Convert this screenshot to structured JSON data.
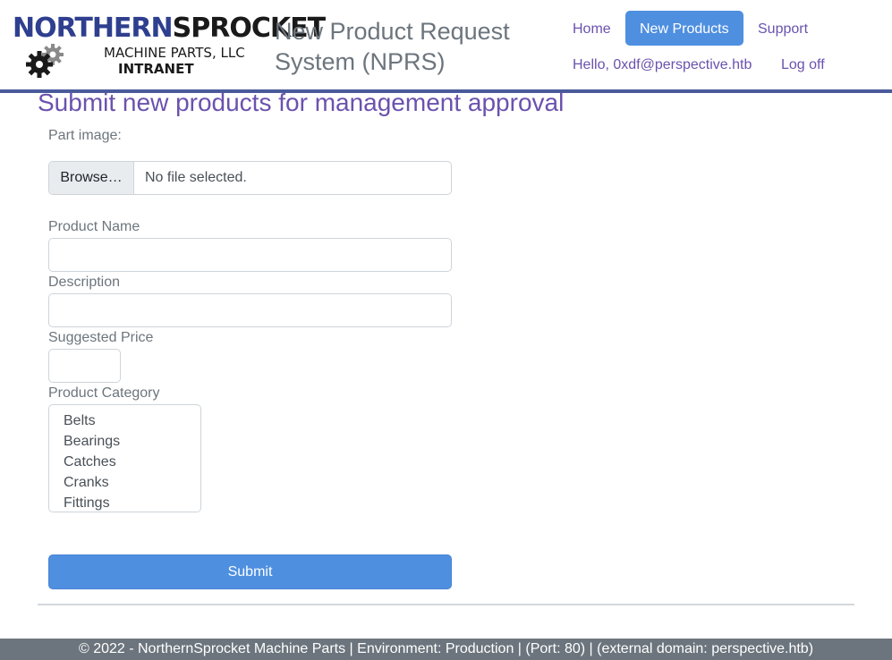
{
  "logo": {
    "top_left": "NORTHERN",
    "top_right": "SPROCKET",
    "middle": "MACHINE PARTS, LLC",
    "bottom": "INTRANET"
  },
  "header": {
    "app_title": "New Product Request System (NPRS)"
  },
  "nav": {
    "home": "Home",
    "new_products": "New Products",
    "support": "Support",
    "greeting": "Hello, 0xdf@perspective.htb",
    "logoff": "Log off"
  },
  "main": {
    "heading": "Submit new products for management approval"
  },
  "form": {
    "part_image_label": "Part image:",
    "browse_label": "Browse…",
    "file_status": "No file selected.",
    "product_name_label": "Product Name",
    "product_name_value": "",
    "description_label": "Description",
    "description_value": "",
    "price_label": "Suggested Price",
    "price_value": "",
    "category_label": "Product Category",
    "categories": [
      "Belts",
      "Bearings",
      "Catches",
      "Cranks",
      "Fittings"
    ],
    "submit_label": "Submit"
  },
  "footer": {
    "text": "© 2022 - NorthernSprocket Machine Parts | Environment: Production | (Port: 80) | (external domain: perspective.htb)"
  },
  "colors": {
    "accent_purple": "#6b52ae",
    "primary_blue": "#4e8fe0",
    "footer_gray": "#6c757d",
    "header_border": "#4a5a9a"
  },
  "icons": [
    "gear-icon"
  ]
}
